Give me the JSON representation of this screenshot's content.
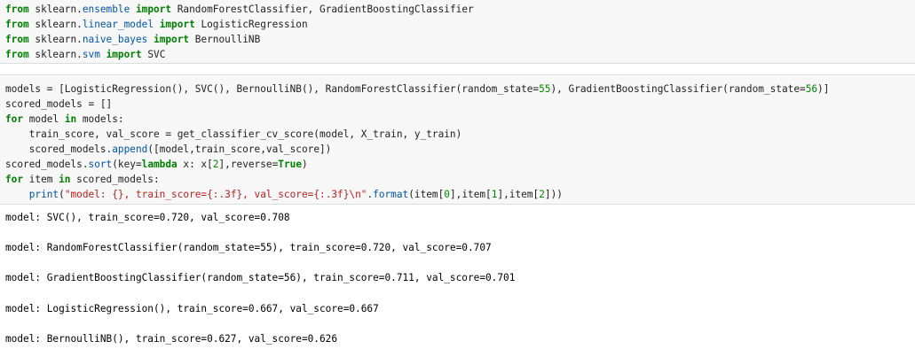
{
  "colors": {
    "keyword": "#008000",
    "module_attr": "#0055aa",
    "number": "#008800",
    "string": "#ba2121",
    "cell_background": "#f7f7f7",
    "text": "#212121"
  },
  "cells": {
    "imports": [
      [
        "from",
        " sklearn.",
        "ensemble",
        " ",
        "import",
        " RandomForestClassifier, GradientBoostingClassifier"
      ],
      [
        "from",
        " sklearn.",
        "linear_model",
        " ",
        "import",
        " LogisticRegression"
      ],
      [
        "from",
        " sklearn.",
        "naive_bayes",
        " ",
        "import",
        " BernoulliNB"
      ],
      [
        "from",
        " sklearn.",
        "svm",
        " ",
        "import",
        " SVC"
      ]
    ],
    "models_code": {
      "line1": {
        "a": "models = [LogisticRegression(), SVC(), BernoulliNB(), RandomForestClassifier(random_state=",
        "n1": "55",
        "b": "), GradientBoostingClassifier(random_state=",
        "n2": "56",
        "c": ")]"
      },
      "line2": "scored_models = []",
      "line3": {
        "k1": "for",
        "a": " model ",
        "k2": "in",
        "b": " models:"
      },
      "line4": "    train_score, val_score = get_classifier_cv_score(model, X_train, y_train)",
      "line5": {
        "a": "    scored_models.",
        "m": "append",
        "b": "([model,train_score,val_score])"
      },
      "line6": {
        "a": "scored_models.",
        "m": "sort",
        "b": "(key=",
        "k1": "lambda",
        "c": " x: x[",
        "n1": "2",
        "d": "],reverse=",
        "k2": "True",
        "e": ")"
      },
      "line7": {
        "k1": "for",
        "a": " item ",
        "k2": "in",
        "b": " scored_models:"
      },
      "line8": {
        "a": "    ",
        "k": "print",
        "b": "(",
        "s": "\"model: {}, train_score={:.3f}, val_score={:.3f}\\n\"",
        "c": ".",
        "m": "format",
        "d": "(item[",
        "n1": "0",
        "e": "],item[",
        "n2": "1",
        "f": "],item[",
        "n3": "2",
        "g": "]))"
      }
    },
    "output": [
      "model: SVC(), train_score=0.720, val_score=0.708",
      "model: RandomForestClassifier(random_state=55), train_score=0.720, val_score=0.707",
      "model: GradientBoostingClassifier(random_state=56), train_score=0.711, val_score=0.701",
      "model: LogisticRegression(), train_score=0.667, val_score=0.667",
      "model: BernoulliNB(), train_score=0.627, val_score=0.626"
    ]
  }
}
